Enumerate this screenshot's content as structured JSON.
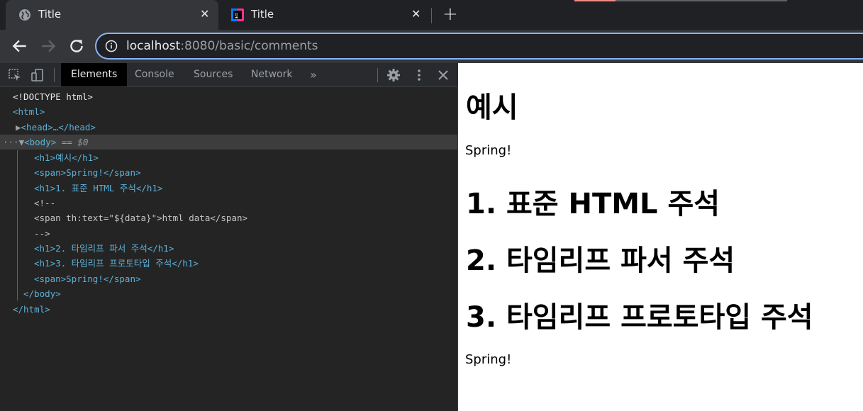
{
  "tabs": [
    {
      "title": "Title",
      "favicon": "globe-icon"
    },
    {
      "title": "Title",
      "favicon": "intellij-icon"
    }
  ],
  "toolbar": {
    "url_host": "localhost",
    "url_rest": ":8080/basic/comments"
  },
  "devtools": {
    "tabs": [
      "Elements",
      "Console",
      "Sources",
      "Network"
    ],
    "active_tab": "Elements",
    "dom_lines": [
      {
        "text": "<!DOCTYPE html>"
      },
      {
        "text": "<html>"
      },
      {
        "text": "<head>…</head>"
      },
      {
        "text": "<body> == $0"
      },
      {
        "text": "<h1>예시</h1>"
      },
      {
        "text": "<span>Spring!</span>"
      },
      {
        "text": "<h1>1. 표준 HTML 주석</h1>"
      },
      {
        "text": "<!--"
      },
      {
        "text": "<span th:text=\"${data}\">html data</span>"
      },
      {
        "text": "-->"
      },
      {
        "text": "<h1>2. 타임리프 파서 주석</h1>"
      },
      {
        "text": "<h1>3. 타임리프 프로토타입 주석</h1>"
      },
      {
        "text": "<span>Spring!</span>"
      },
      {
        "text": "</body>"
      },
      {
        "text": "</html>"
      }
    ]
  },
  "page": {
    "h1_example": "예시",
    "span1": "Spring!",
    "h1_1": "1. 표준 HTML 주석",
    "h1_2": "2. 타임리프 파서 주석",
    "h1_3": "3. 타임리프 프로토타입 주석",
    "span2": "Spring!"
  },
  "colors": {
    "accent": "#8ab4f8",
    "tag": "#5db0d7"
  }
}
